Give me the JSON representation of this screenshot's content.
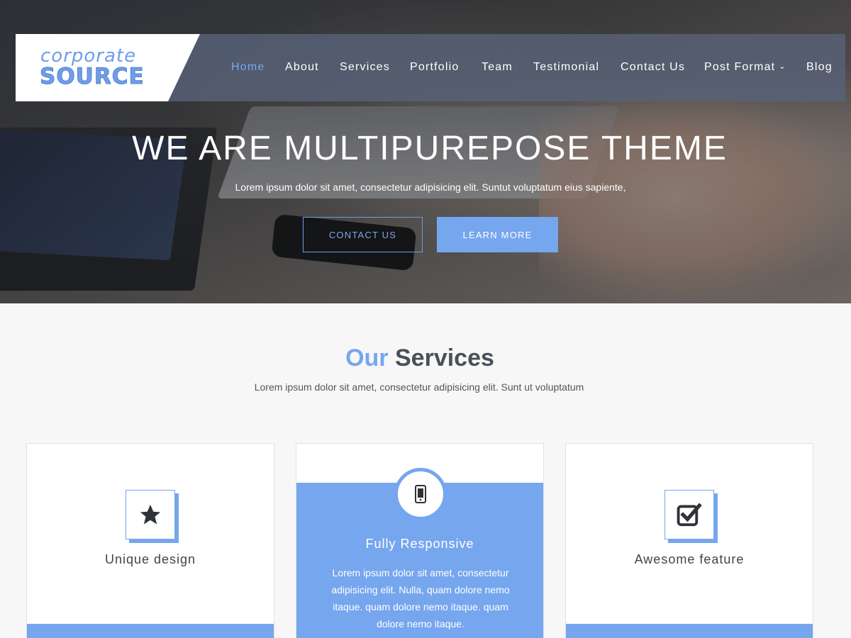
{
  "logo": {
    "top": "corporate",
    "bottom": "SOURCE"
  },
  "nav": {
    "items": [
      {
        "label": "Home",
        "active": true
      },
      {
        "label": "About"
      },
      {
        "label": "Services"
      },
      {
        "label": "Portfolio"
      },
      {
        "label": "Team"
      },
      {
        "label": "Testimonial"
      },
      {
        "label": "Contact Us"
      },
      {
        "label": "Post Format",
        "has_dropdown": true
      },
      {
        "label": "Blog"
      }
    ]
  },
  "hero": {
    "title": "WE ARE MULTIPUREPOSE THEME",
    "subtitle": "Lorem ipsum dolor sit amet, consectetur adipisicing elit. Suntut voluptatum eius sapiente,",
    "btn_contact": "CONTACT US",
    "btn_learn": "LEARN MORE"
  },
  "services": {
    "title_accent": "Our",
    "title_rest": "Services",
    "subtitle": "Lorem ipsum dolor sit amet, consectetur adipisicing elit. Sunt ut voluptatum",
    "cards": [
      {
        "title": "Unique design",
        "icon": "star-icon"
      },
      {
        "title": "Fully Responsive",
        "icon": "mobile-icon",
        "text": "Lorem ipsum dolor sit amet, consectetur adipisicing elit. Nulla, quam dolore nemo itaque. quam dolore nemo itaque. quam dolore nemo itaque."
      },
      {
        "title": "Awesome feature",
        "icon": "check-square-icon"
      }
    ]
  },
  "colors": {
    "accent": "#76a6ee",
    "nav_bg": "#586278",
    "text_dark": "#4a4f5a"
  }
}
